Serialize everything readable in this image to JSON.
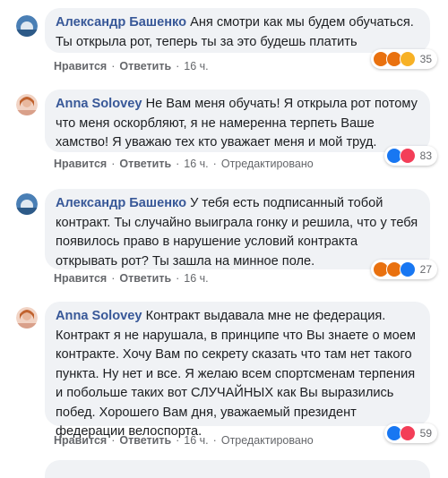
{
  "comments": [
    {
      "author": "Александр Башенко",
      "text": "Аня смотри как мы будем обучаться. Ты открыла рот, теперь ты за это будешь платить",
      "actions": {
        "like": "Нравится",
        "reply": "Ответить",
        "time": "16 ч.",
        "edited": ""
      },
      "reactions": {
        "icons": [
          "angry-icon",
          "angry-icon",
          "wow-icon"
        ],
        "count": "35"
      }
    },
    {
      "author": "Anna Solovey",
      "text": "Не Вам меня обучать! Я открыла рот потому что меня оскорбляют, я не намеренна терпеть Ваше хамство! Я уважаю тех кто уважает меня и мой труд.",
      "actions": {
        "like": "Нравится",
        "reply": "Ответить",
        "time": "16 ч.",
        "edited": "Отредактировано"
      },
      "reactions": {
        "icons": [
          "like-icon",
          "love-icon"
        ],
        "count": "83"
      }
    },
    {
      "author": "Александр Башенко",
      "text": "У тебя есть подписанный тобой контракт. Ты случайно выиграла гонку и решила, что у тебя появилось право в нарушение условий контракта открывать рот? Ты зашла на минное поле.",
      "actions": {
        "like": "Нравится",
        "reply": "Ответить",
        "time": "16 ч.",
        "edited": ""
      },
      "reactions": {
        "icons": [
          "angry-icon",
          "angry-icon",
          "like-icon"
        ],
        "count": "27"
      }
    },
    {
      "author": "Anna Solovey",
      "text": "Контракт выдавала мне не федерация. Контракт я не нарушала, в принципе что Вы знаете о моем контракте. Хочу Вам по секрету сказать что там нет такого пункта. Ну нет и все. Я желаю всем спортсменам терпения и побольше таких вот СЛУЧАЙНЫХ как Вы выразились побед. Хорошего Вам дня, уважаемый президент федерации велоспорта.",
      "actions": {
        "like": "Нравится",
        "reply": "Ответить",
        "time": "16 ч.",
        "edited": "Отредактировано"
      },
      "reactions": {
        "icons": [
          "like-icon",
          "love-icon"
        ],
        "count": "59"
      }
    }
  ],
  "colors": {
    "author": "#385898",
    "bubble": "#f0f2f5",
    "meta": "#65676b",
    "like": "#1877f2",
    "love": "#f33e58",
    "angry": "#e9710f",
    "wow": "#f7b125"
  }
}
